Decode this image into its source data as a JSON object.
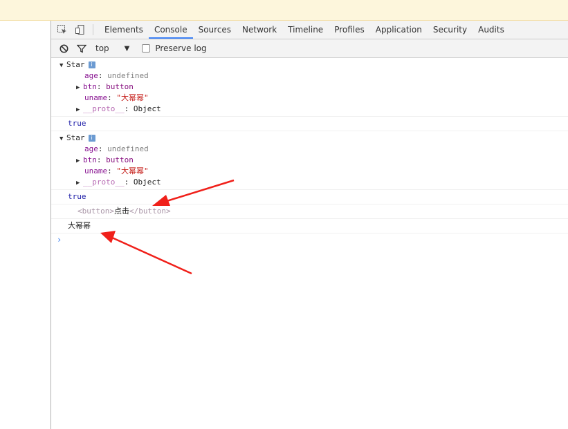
{
  "tabs": [
    "Elements",
    "Console",
    "Sources",
    "Network",
    "Timeline",
    "Profiles",
    "Application",
    "Security",
    "Audits"
  ],
  "active_tab": "Console",
  "console_toolbar": {
    "context": "top",
    "preserve_log_label": "Preserve log",
    "preserve_log_checked": false
  },
  "console": {
    "obj1": {
      "name": "Star",
      "info_badge": "i",
      "age_key": "age",
      "age_val": "undefined",
      "btn_key": "btn",
      "btn_val": "button",
      "uname_key": "uname",
      "uname_val": "\"大幂幂\"",
      "proto_key": "__proto__",
      "proto_val": "Object"
    },
    "true1": "true",
    "obj2": {
      "name": "Star",
      "info_badge": "i",
      "age_key": "age",
      "age_val": "undefined",
      "btn_key": "btn",
      "btn_val": "button",
      "uname_key": "uname",
      "uname_val": "\"大幂幂\"",
      "proto_key": "__proto__",
      "proto_val": "Object"
    },
    "true2": "true",
    "element": {
      "open_tag": "<button>",
      "text": "点击",
      "close_tag": "</button>"
    },
    "log_text": "大幂幂",
    "prompt": "›"
  },
  "colors": {
    "annotation_arrow": "#f0201a",
    "active_tab_underline": "#3e82f7"
  },
  "icons": [
    "inspect-icon",
    "device-toggle-icon",
    "clear-console-icon",
    "filter-icon",
    "dropdown-arrow-icon",
    "expand-triangle-icon",
    "info-icon"
  ]
}
